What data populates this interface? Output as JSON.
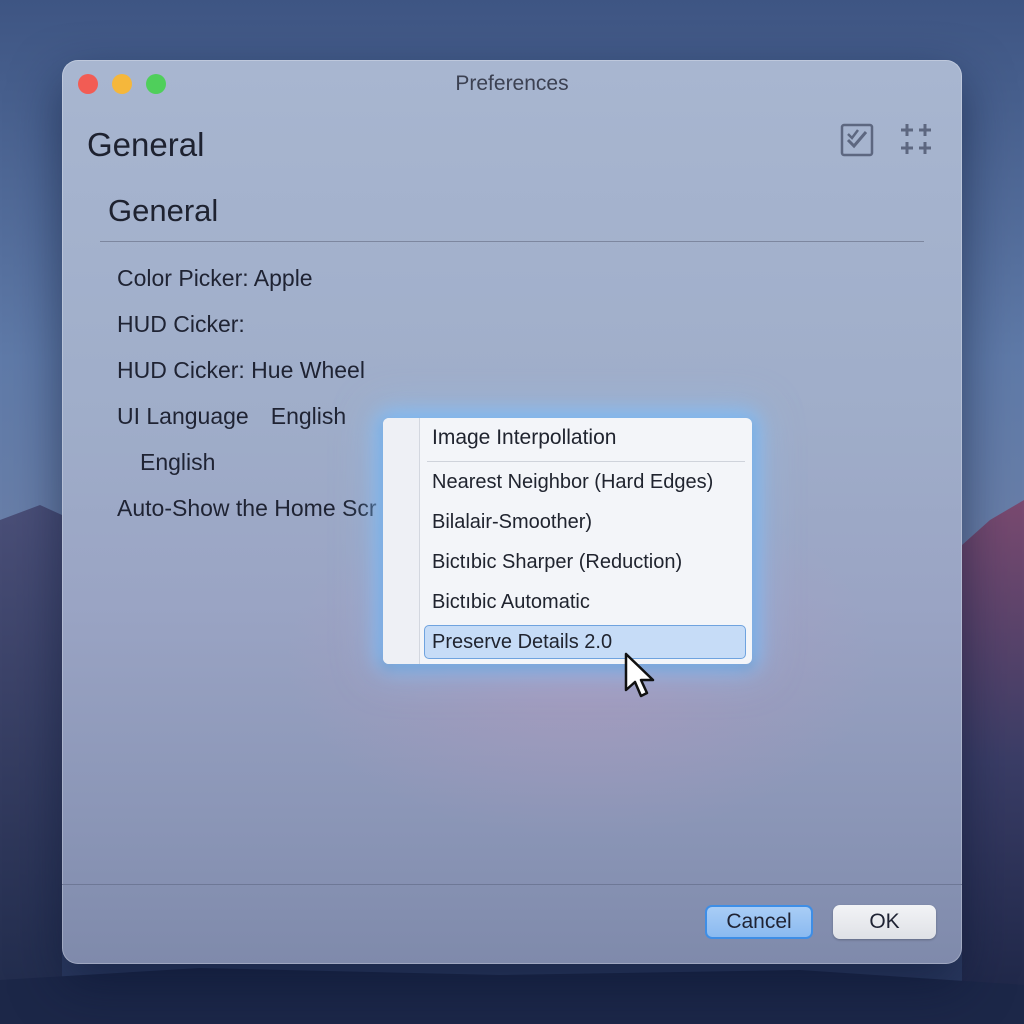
{
  "window": {
    "title": "Preferences"
  },
  "header": {
    "title": "General",
    "icons": [
      "checklist-icon",
      "grid-plus-icon"
    ]
  },
  "section": {
    "title": "General"
  },
  "settings": {
    "color_picker": "Color Picker: Apple",
    "hud_picker": "HUD Cicker:",
    "hud_picker_value": "HUD Cicker: Hue Wheel",
    "ui_language_label": "UI Language",
    "ui_language_value": "English",
    "language_sub": "English",
    "auto_show": "Auto-Show the Home Scr"
  },
  "popup": {
    "header": "Image Interpollation",
    "items": [
      "Nearest Neighbor (Hard Edges)",
      "Bilalair-Smoother)",
      "Bictıbic Sharper (Reduction)",
      "Bictıbic Automatic",
      "Preserve Details 2.0"
    ],
    "selected_index": 4
  },
  "footer": {
    "cancel_label": "Cancel",
    "ok_label": "OK"
  },
  "colors": {
    "accent": "#3e8ee6",
    "selection": "#c6dcf7",
    "close": "#f25c54",
    "minimize": "#f5b73b",
    "maximize": "#4fcf5b"
  }
}
